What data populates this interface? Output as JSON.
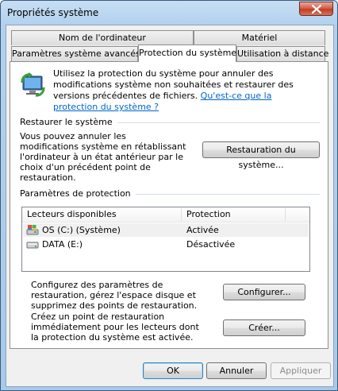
{
  "window": {
    "title": "Propriétés système"
  },
  "tabs": {
    "row1": [
      {
        "label": "Nom de l'ordinateur"
      },
      {
        "label": "Matériel"
      }
    ],
    "row2": [
      {
        "label": "Paramètres système avancés"
      },
      {
        "label": "Protection du système",
        "active": true
      },
      {
        "label": "Utilisation à distance"
      }
    ]
  },
  "intro": {
    "text": "Utilisez la protection du système pour annuler des modifications système non souhaitées et restaurer des versions précédentes de fichiers.",
    "link": "Qu'est-ce que la protection du système ?"
  },
  "restore": {
    "title": "Restaurer le système",
    "description": "Vous pouvez annuler les modifications système en rétablissant l'ordinateur à un état antérieur par le choix d'un précédent point de restauration.",
    "button": "Restauration du système..."
  },
  "protection": {
    "title": "Paramètres de protection",
    "columns": [
      "Lecteurs disponibles",
      "Protection"
    ],
    "rows": [
      {
        "drive": "OS (C:) (Système)",
        "status": "Activée",
        "icon": "system-drive-icon"
      },
      {
        "drive": "DATA (E:)",
        "status": "Désactivée",
        "icon": "hard-drive-icon"
      }
    ],
    "configure_text": "Configurez des paramètres de restauration, gérez l'espace disque et supprimez des points de restauration.",
    "configure_button": "Configurer...",
    "create_text": "Créez un point de restauration immédiatement pour les lecteurs dont la protection du système est activée.",
    "create_button": "Créer..."
  },
  "footer": {
    "ok": "OK",
    "cancel": "Annuler",
    "apply": "Appliquer"
  },
  "colors": {
    "link": "#0066cc",
    "close_button": "#c23d24",
    "title_bar": "#b3d1ee"
  }
}
